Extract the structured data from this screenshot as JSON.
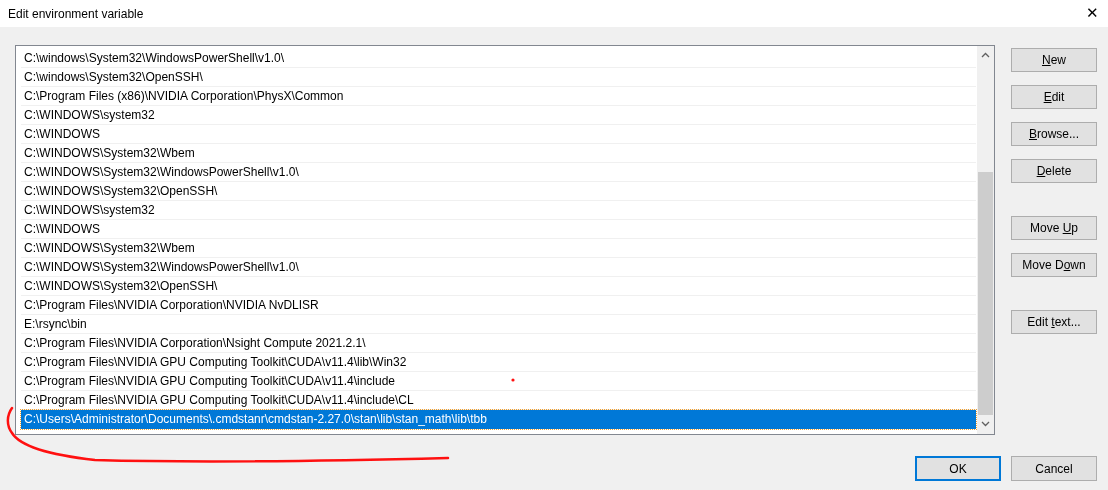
{
  "window": {
    "title": "Edit environment variable",
    "close": "✕"
  },
  "list": {
    "rows": [
      {
        "text": "C:\\windows\\System32\\WindowsPowerShell\\v1.0\\",
        "selected": false
      },
      {
        "text": "C:\\windows\\System32\\OpenSSH\\",
        "selected": false
      },
      {
        "text": "C:\\Program Files (x86)\\NVIDIA Corporation\\PhysX\\Common",
        "selected": false
      },
      {
        "text": "C:\\WINDOWS\\system32",
        "selected": false
      },
      {
        "text": "C:\\WINDOWS",
        "selected": false
      },
      {
        "text": "C:\\WINDOWS\\System32\\Wbem",
        "selected": false
      },
      {
        "text": "C:\\WINDOWS\\System32\\WindowsPowerShell\\v1.0\\",
        "selected": false
      },
      {
        "text": "C:\\WINDOWS\\System32\\OpenSSH\\",
        "selected": false
      },
      {
        "text": "C:\\WINDOWS\\system32",
        "selected": false
      },
      {
        "text": "C:\\WINDOWS",
        "selected": false
      },
      {
        "text": "C:\\WINDOWS\\System32\\Wbem",
        "selected": false
      },
      {
        "text": "C:\\WINDOWS\\System32\\WindowsPowerShell\\v1.0\\",
        "selected": false
      },
      {
        "text": "C:\\WINDOWS\\System32\\OpenSSH\\",
        "selected": false
      },
      {
        "text": "C:\\Program Files\\NVIDIA Corporation\\NVIDIA NvDLISR",
        "selected": false
      },
      {
        "text": "E:\\rsync\\bin",
        "selected": false
      },
      {
        "text": "C:\\Program Files\\NVIDIA Corporation\\Nsight Compute 2021.2.1\\",
        "selected": false
      },
      {
        "text": "C:\\Program Files\\NVIDIA GPU Computing Toolkit\\CUDA\\v11.4\\lib\\Win32",
        "selected": false
      },
      {
        "text": "C:\\Program Files\\NVIDIA GPU Computing Toolkit\\CUDA\\v11.4\\include",
        "selected": false
      },
      {
        "text": "C:\\Program Files\\NVIDIA GPU Computing Toolkit\\CUDA\\v11.4\\include\\CL",
        "selected": false
      },
      {
        "text": "C:\\Users\\Administrator\\Documents\\.cmdstanr\\cmdstan-2.27.0\\stan\\lib\\stan_math\\lib\\tbb",
        "selected": true
      }
    ]
  },
  "side_button_groups": [
    [
      {
        "key": "N",
        "after": "ew"
      },
      {
        "key": "E",
        "after": "dit"
      },
      {
        "key": "B",
        "after": "rowse..."
      },
      {
        "key": "D",
        "after": "elete"
      }
    ],
    [
      {
        "before": "Move ",
        "key": "U",
        "after": "p"
      },
      {
        "before": "Move D",
        "key": "o",
        "after": "wn"
      }
    ],
    [
      {
        "before": "Edit ",
        "key": "t",
        "after": "ext..."
      }
    ]
  ],
  "footer_buttons": [
    {
      "label": "OK",
      "default": true
    },
    {
      "label": "Cancel",
      "default": false
    }
  ]
}
